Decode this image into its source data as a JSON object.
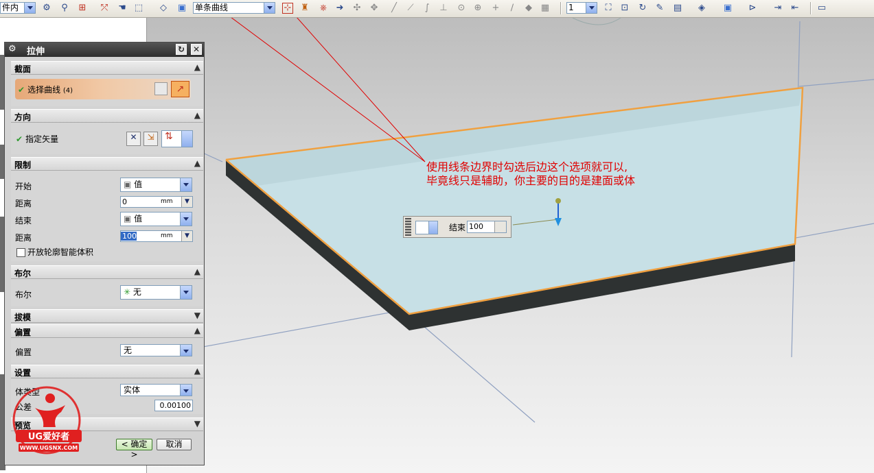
{
  "toolbar": {
    "filter_combo": "件内",
    "curve_rule": "单条曲线",
    "layer_combo": "1"
  },
  "viewport": {
    "annotation_line1": "使用线条边界时勾选后边这个选项就可以,",
    "annotation_line2": "毕竟线只是辅助，你主要的目的是建面或体",
    "onscreen_label": "结束",
    "onscreen_value": "100"
  },
  "dialog": {
    "title": "拉伸",
    "section": {
      "label": "截面",
      "select_curve": "选择曲线",
      "select_count": "(4)"
    },
    "direction": {
      "label": "方向",
      "specify_vector": "指定矢量"
    },
    "limits": {
      "label": "限制",
      "start_label": "开始",
      "start_option": "值",
      "start_distance_label": "距离",
      "start_distance": "0",
      "end_label": "结束",
      "end_option": "值",
      "end_distance_label": "距离",
      "end_distance": "100",
      "unit": "mm",
      "open_profile_smart_volume": "开放轮廓智能体积"
    },
    "boolean": {
      "label": "布尔",
      "field_label": "布尔",
      "value": "无"
    },
    "draft": {
      "label": "拔模"
    },
    "offset": {
      "label": "偏置",
      "field_label": "偏置",
      "value": "无"
    },
    "settings": {
      "label": "设置",
      "body_type_label": "体类型",
      "body_type": "实体",
      "tolerance_label": "公差",
      "tolerance": "0.00100"
    },
    "preview": {
      "label": "预览"
    },
    "ok_label": "< 确定 >",
    "cancel_label": "取消"
  },
  "watermark": {
    "brand": "UG爱好者",
    "url": "WWW.UGSNX.COM"
  },
  "colors": {
    "annotation": "#e00000",
    "edge_highlight": "#f0a040",
    "face": "#c7e0e6",
    "dialog_title": "#333333"
  }
}
